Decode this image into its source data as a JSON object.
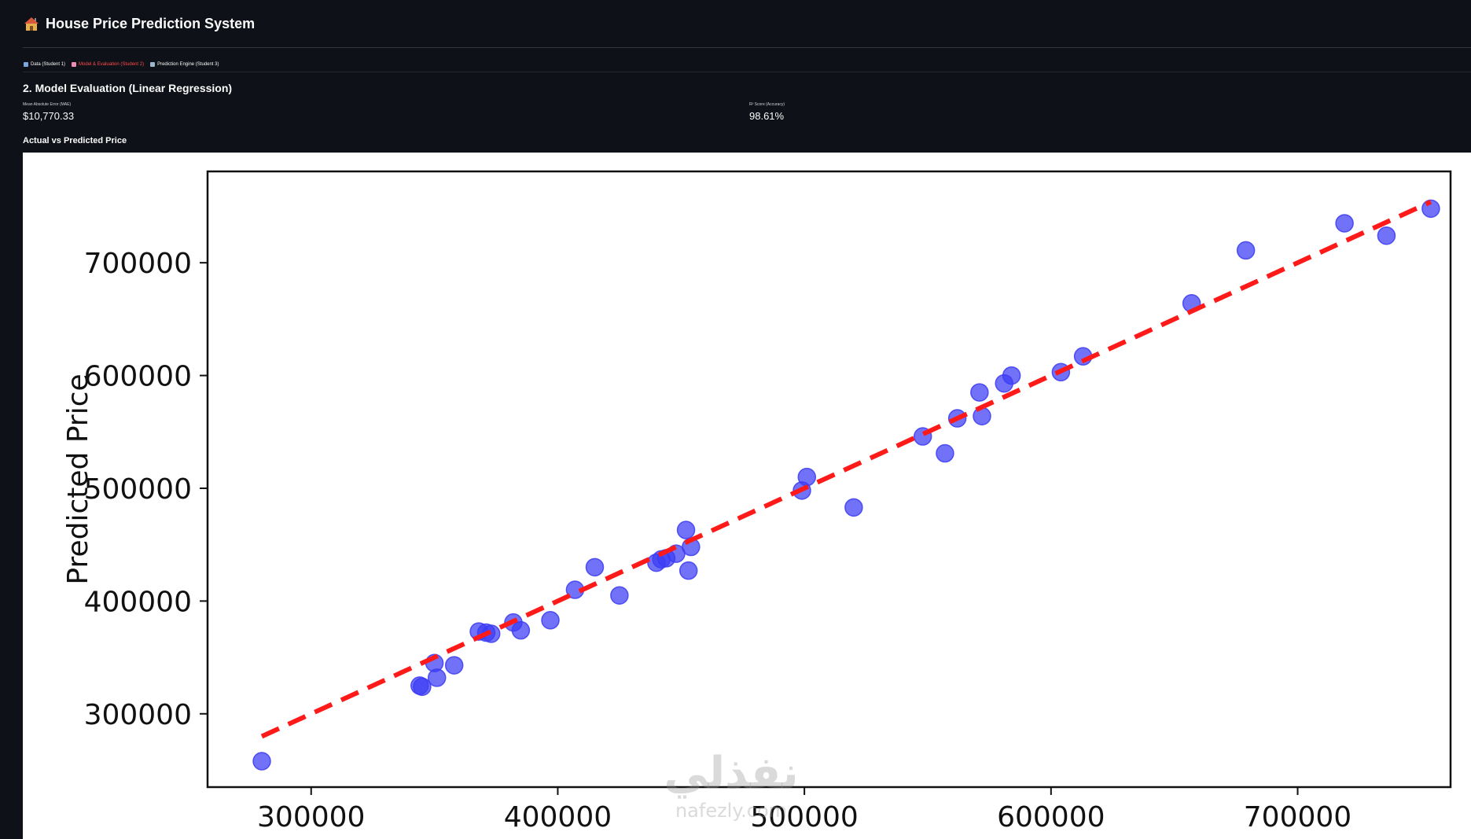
{
  "header": {
    "icon": "house-icon",
    "title": "House Price Prediction System"
  },
  "tabs": [
    {
      "label": "Data (Student 1)",
      "icon": "table-icon",
      "active": false
    },
    {
      "label": "Model & Evaluation (Student 2)",
      "icon": "brain-icon",
      "active": true
    },
    {
      "label": "Prediction Engine (Student 3)",
      "icon": "calculator-icon",
      "active": false
    }
  ],
  "section": {
    "title": "2. Model Evaluation (Linear Regression)"
  },
  "metrics": [
    {
      "label": "Mean Absolute Error (MAE)",
      "value": "$10,770.33"
    },
    {
      "label": "R² Score (Accuracy)",
      "value": "98.61%"
    }
  ],
  "subheader": "Actual vs Predicted Price",
  "watermark": {
    "logo": "نفذلي",
    "text": "nafezly.com"
  },
  "colors": {
    "background": "#0e1117",
    "active_tab": "#ff4b4b",
    "point": "#3b3bf5",
    "fit_line": "#ff1a1a"
  },
  "chart_data": {
    "type": "scatter",
    "title": "",
    "xlabel": "",
    "ylabel": "Predicted Price",
    "xlim": [
      258000,
      762000
    ],
    "ylim": [
      235000,
      781000
    ],
    "xticks": [
      300000,
      400000,
      500000,
      600000,
      700000
    ],
    "yticks": [
      300000,
      400000,
      500000,
      600000,
      700000
    ],
    "grid": false,
    "points": [
      [
        280000,
        258000
      ],
      [
        344000,
        325000
      ],
      [
        345000,
        324000
      ],
      [
        350000,
        345000
      ],
      [
        351000,
        332000
      ],
      [
        358000,
        343000
      ],
      [
        368000,
        373000
      ],
      [
        371000,
        372000
      ],
      [
        373000,
        371000
      ],
      [
        382000,
        381000
      ],
      [
        385000,
        374000
      ],
      [
        397000,
        383000
      ],
      [
        407000,
        410000
      ],
      [
        415000,
        430000
      ],
      [
        425000,
        405000
      ],
      [
        440000,
        434000
      ],
      [
        442000,
        437000
      ],
      [
        444000,
        438000
      ],
      [
        448000,
        442000
      ],
      [
        452000,
        463000
      ],
      [
        454000,
        448000
      ],
      [
        453000,
        427000
      ],
      [
        499000,
        498000
      ],
      [
        501000,
        510000
      ],
      [
        520000,
        483000
      ],
      [
        548000,
        546000
      ],
      [
        557000,
        531000
      ],
      [
        562000,
        562000
      ],
      [
        571000,
        585000
      ],
      [
        572000,
        564000
      ],
      [
        581000,
        593000
      ],
      [
        584000,
        600000
      ],
      [
        604000,
        603000
      ],
      [
        613000,
        617000
      ],
      [
        657000,
        664000
      ],
      [
        679000,
        711000
      ],
      [
        719000,
        735000
      ],
      [
        736000,
        724000
      ],
      [
        754000,
        748000
      ]
    ],
    "fit_line": {
      "x": [
        280000,
        754000
      ],
      "y": [
        280000,
        754000
      ],
      "style": "dashed"
    }
  }
}
